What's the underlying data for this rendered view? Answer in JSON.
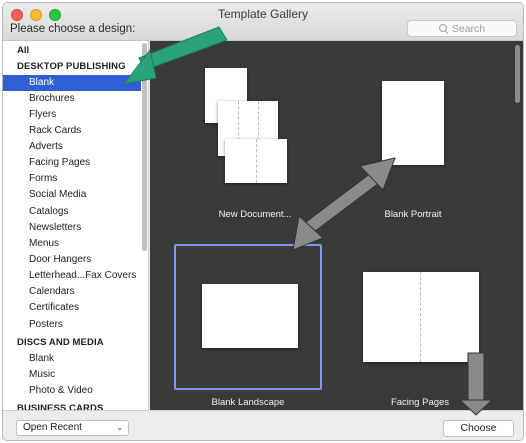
{
  "window": {
    "title": "Template Gallery",
    "prompt": "Please choose a design:",
    "search_placeholder": "Search"
  },
  "sidebar": {
    "all_label": "All",
    "sections": [
      {
        "header": "DESKTOP PUBLISHING",
        "items": [
          "Blank",
          "Brochures",
          "Flyers",
          "Rack Cards",
          "Adverts",
          "Facing Pages",
          "Forms",
          "Social Media",
          "Catalogs",
          "Newsletters",
          "Menus",
          "Door Hangers",
          "Letterhead...Fax Covers",
          "Calendars",
          "Certificates",
          "Posters"
        ]
      },
      {
        "header": "DISCS AND MEDIA",
        "items": [
          "Blank",
          "Music",
          "Photo & Video"
        ]
      },
      {
        "header": "BUSINESS CARDS",
        "items": []
      }
    ],
    "selected_item": "Blank"
  },
  "templates": [
    {
      "name": "New Document..."
    },
    {
      "name": "Blank Portrait"
    },
    {
      "name": "Blank Landscape",
      "selected": true
    },
    {
      "name": "Facing Pages"
    }
  ],
  "footer": {
    "open_recent_label": "Open Recent",
    "choose_label": "Choose"
  },
  "colors": {
    "selection": "#2f5fd2",
    "annotation_arrow": "#2aa37a",
    "annotation_gray_arrow": "#8a8a8a"
  }
}
